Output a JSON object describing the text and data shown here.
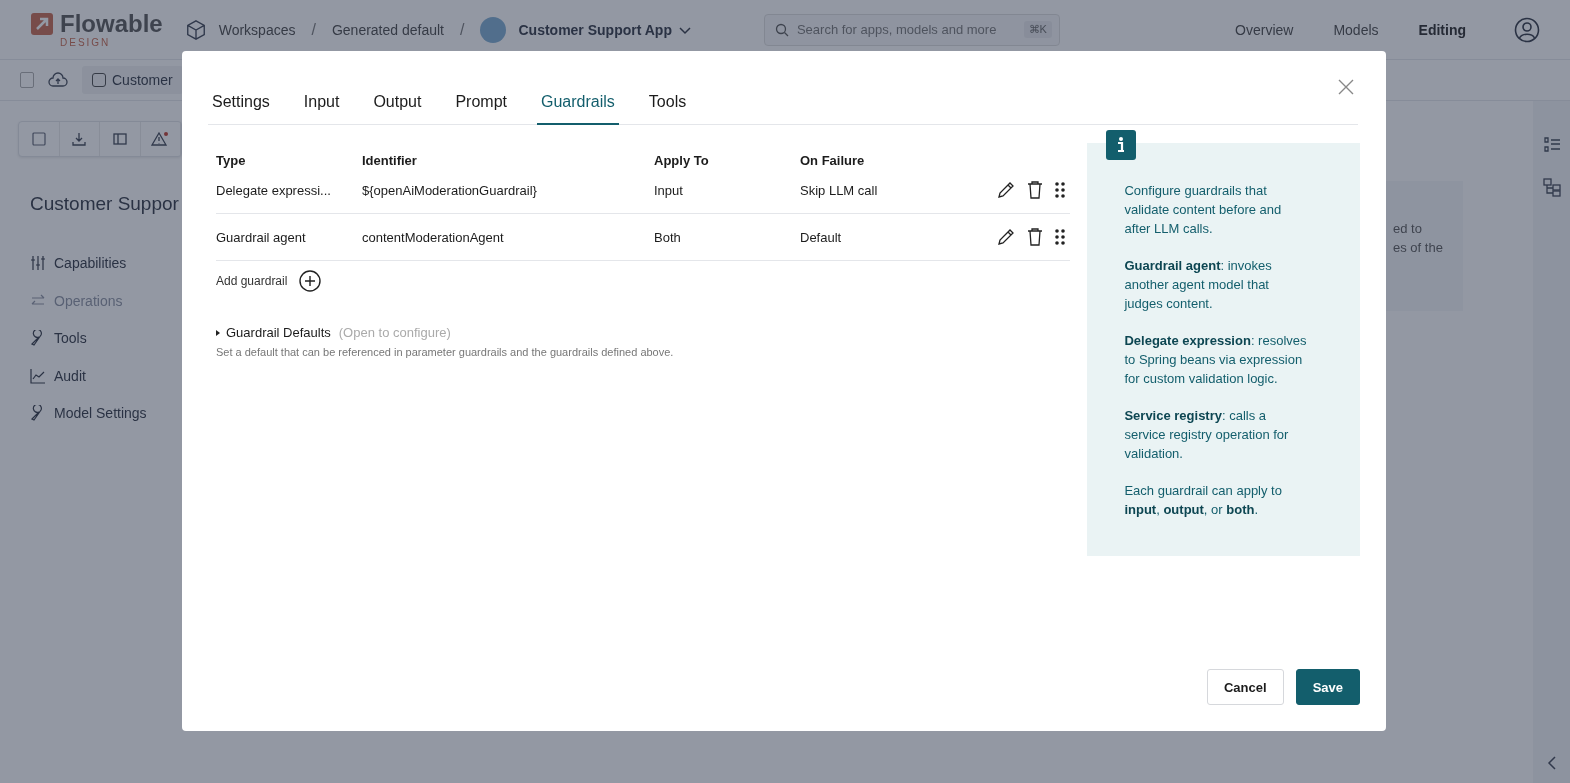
{
  "app": {
    "logo": {
      "name": "Flowable",
      "subtitle": "DESIGN"
    },
    "breadcrumbs": [
      {
        "label": "Workspaces",
        "separator": "/"
      },
      {
        "label": "Generated default",
        "separator": "/"
      }
    ],
    "app_name": "Customer Support App",
    "search": {
      "placeholder": "Search for apps, models and more",
      "shortcut": "⌘K"
    },
    "nav": [
      {
        "label": "Overview",
        "selected": false
      },
      {
        "label": "Models",
        "selected": false
      },
      {
        "label": "Editing",
        "selected": true
      }
    ],
    "file_tab": "Customer",
    "page_title": "Customer Suppor",
    "sidebar": [
      {
        "label": "Capabilities",
        "disabled": false
      },
      {
        "label": "Operations",
        "disabled": true
      },
      {
        "label": "Tools",
        "disabled": false
      },
      {
        "label": "Audit",
        "disabled": false
      },
      {
        "label": "Model Settings",
        "disabled": false
      }
    ],
    "card_lines": [
      "ed to",
      "es of the"
    ]
  },
  "dialog": {
    "tabs": [
      {
        "label": "Settings",
        "selected": false
      },
      {
        "label": "Input",
        "selected": false
      },
      {
        "label": "Output",
        "selected": false
      },
      {
        "label": "Prompt",
        "selected": false
      },
      {
        "label": "Guardrails",
        "selected": true
      },
      {
        "label": "Tools",
        "selected": false
      }
    ],
    "table": {
      "columns": [
        "Type",
        "Identifier",
        "Apply To",
        "On Failure"
      ],
      "rows": [
        {
          "type": "Delegate expressi...",
          "identifier": "${openAiModerationGuardrail}",
          "apply_to": "Input",
          "on_failure": "Skip LLM call"
        },
        {
          "type": "Guardrail agent",
          "identifier": "contentModerationAgent",
          "apply_to": "Both",
          "on_failure": "Default"
        }
      ]
    },
    "add_label": "Add guardrail",
    "defaults": {
      "title": "Guardrail Defaults",
      "hint": "(Open to configure)",
      "expanded": false,
      "description": "Set a default that can be referenced in parameter guardrails and the guardrails defined above."
    },
    "info": [
      "Configure guardrails that validate content before and after LLM calls.",
      "**Guardrail agent**: invokes another agent model that judges content.",
      "**Delegate expression**: resolves to Spring beans via expression for custom validation logic.",
      "**Service registry**: calls a service registry operation for validation.",
      "Each guardrail can apply to **input**, **output**, or **both**."
    ],
    "buttons": [
      {
        "label": "Cancel",
        "kind": "secondary"
      },
      {
        "label": "Save",
        "kind": "primary"
      }
    ]
  }
}
